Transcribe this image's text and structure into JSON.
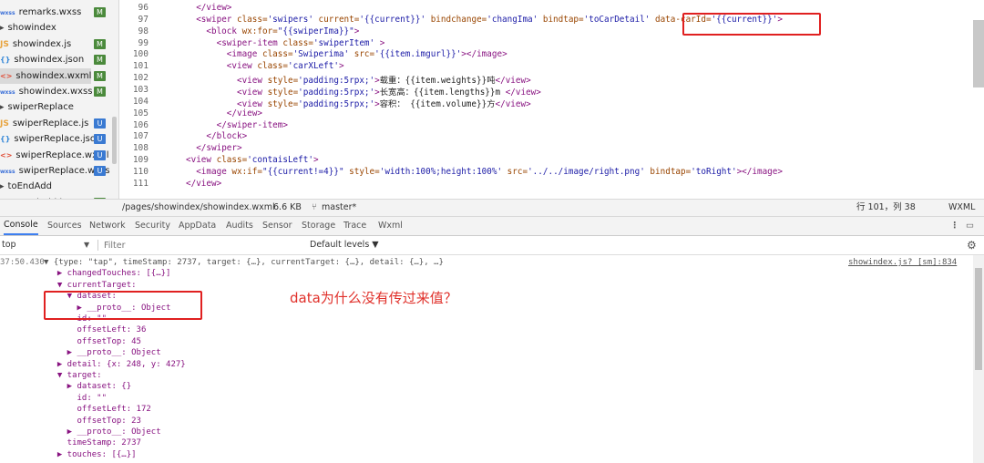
{
  "file_tree": [
    {
      "icon": "wxss",
      "label": "remarks.wxss",
      "badge": "M"
    },
    {
      "icon": "folder",
      "label": "showindex",
      "badge": ""
    },
    {
      "icon": "js",
      "label": "showindex.js",
      "badge": "M"
    },
    {
      "icon": "json",
      "label": "showindex.json",
      "badge": "M"
    },
    {
      "icon": "wxml",
      "label": "showindex.wxml",
      "badge": "M"
    },
    {
      "icon": "wxss",
      "label": "showindex.wxss",
      "badge": "M"
    },
    {
      "icon": "folder",
      "label": "swiperReplace",
      "badge": ""
    },
    {
      "icon": "js",
      "label": "swiperReplace.js",
      "badge": "U"
    },
    {
      "icon": "json",
      "label": "swiperReplace.json",
      "badge": "U"
    },
    {
      "icon": "wxml",
      "label": "swiperReplace.wxml",
      "badge": "U"
    },
    {
      "icon": "wxss",
      "label": "swiperReplace.wxss",
      "badge": "U"
    },
    {
      "icon": "folder",
      "label": "toEndAdd",
      "badge": ""
    },
    {
      "icon": "js",
      "label": "toEndAdd.js",
      "badge": "M"
    }
  ],
  "icon_glyphs": {
    "wxss": "wxss",
    "js": "JS",
    "json": "{}",
    "wxml": "<>",
    "folder": "▸"
  },
  "editor": {
    "line_numbers": [
      "96",
      "97",
      "98",
      "99",
      "100",
      "101",
      "102",
      "103",
      "104",
      "105",
      "106",
      "107",
      "108",
      "109",
      "110",
      "111"
    ],
    "lines": [
      [
        {
          "c": "txt",
          "t": "  "
        },
        {
          "c": "tag",
          "t": "</view>"
        }
      ],
      [
        {
          "c": "txt",
          "t": "  "
        },
        {
          "c": "tag",
          "t": "<swiper"
        },
        {
          "c": "attr",
          "t": " class="
        },
        {
          "c": "val",
          "t": "'swipers'"
        },
        {
          "c": "attr",
          "t": " current="
        },
        {
          "c": "val",
          "t": "'{{current}}'"
        },
        {
          "c": "attr",
          "t": " bindchange="
        },
        {
          "c": "val",
          "t": "'changIma'"
        },
        {
          "c": "attr",
          "t": " bindtap="
        },
        {
          "c": "val",
          "t": "'toCarDetail'"
        },
        {
          "c": "attr",
          "t": " data-carId="
        },
        {
          "c": "val",
          "t": "'{{current}}'"
        },
        {
          "c": "tag",
          "t": ">"
        }
      ],
      [
        {
          "c": "txt",
          "t": "    "
        },
        {
          "c": "tag",
          "t": "<block"
        },
        {
          "c": "attr",
          "t": " wx:for="
        },
        {
          "c": "val",
          "t": "\"{{swiperIma}}\""
        },
        {
          "c": "tag",
          "t": ">"
        }
      ],
      [
        {
          "c": "txt",
          "t": "      "
        },
        {
          "c": "tag",
          "t": "<swiper-item"
        },
        {
          "c": "attr",
          "t": " class="
        },
        {
          "c": "val",
          "t": "'swiperItem'"
        },
        {
          "c": "tag",
          "t": " >"
        }
      ],
      [
        {
          "c": "txt",
          "t": "        "
        },
        {
          "c": "tag",
          "t": "<image"
        },
        {
          "c": "attr",
          "t": " class="
        },
        {
          "c": "val",
          "t": "'Swiperima'"
        },
        {
          "c": "attr",
          "t": " src="
        },
        {
          "c": "val",
          "t": "'{{item.imgurl}}'"
        },
        {
          "c": "tag",
          "t": "></image>"
        }
      ],
      [
        {
          "c": "txt",
          "t": "        "
        },
        {
          "c": "tag",
          "t": "<view"
        },
        {
          "c": "attr",
          "t": " class="
        },
        {
          "c": "val",
          "t": "'carXLeft'"
        },
        {
          "c": "tag",
          "t": ">"
        }
      ],
      [
        {
          "c": "txt",
          "t": "          "
        },
        {
          "c": "tag",
          "t": "<view"
        },
        {
          "c": "attr",
          "t": " style="
        },
        {
          "c": "val",
          "t": "'padding:5rpx;'"
        },
        {
          "c": "tag",
          "t": ">"
        },
        {
          "c": "txt",
          "t": "载重：{{item.weights}}吨"
        },
        {
          "c": "tag",
          "t": "</view>"
        }
      ],
      [
        {
          "c": "txt",
          "t": "          "
        },
        {
          "c": "tag",
          "t": "<view"
        },
        {
          "c": "attr",
          "t": " style="
        },
        {
          "c": "val",
          "t": "'padding:5rpx;'"
        },
        {
          "c": "tag",
          "t": ">"
        },
        {
          "c": "txt",
          "t": "长宽高：{{item.lengths}}m "
        },
        {
          "c": "tag",
          "t": "</view>"
        }
      ],
      [
        {
          "c": "txt",
          "t": "          "
        },
        {
          "c": "tag",
          "t": "<view"
        },
        {
          "c": "attr",
          "t": " style="
        },
        {
          "c": "val",
          "t": "'padding:5rpx;'"
        },
        {
          "c": "tag",
          "t": ">"
        },
        {
          "c": "txt",
          "t": "容积： {{item.volume}}方"
        },
        {
          "c": "tag",
          "t": "</view>"
        }
      ],
      [
        {
          "c": "txt",
          "t": "        "
        },
        {
          "c": "tag",
          "t": "</view>"
        }
      ],
      [
        {
          "c": "txt",
          "t": "      "
        },
        {
          "c": "tag",
          "t": "</swiper-item>"
        }
      ],
      [
        {
          "c": "txt",
          "t": "    "
        },
        {
          "c": "tag",
          "t": "</block>"
        }
      ],
      [
        {
          "c": "txt",
          "t": "  "
        },
        {
          "c": "tag",
          "t": "</swiper>"
        }
      ],
      [
        {
          "c": "tag",
          "t": "<view"
        },
        {
          "c": "attr",
          "t": " class="
        },
        {
          "c": "val",
          "t": "'contaisLeft'"
        },
        {
          "c": "tag",
          "t": ">"
        }
      ],
      [
        {
          "c": "txt",
          "t": "  "
        },
        {
          "c": "tag",
          "t": "<image"
        },
        {
          "c": "attr",
          "t": " wx:if="
        },
        {
          "c": "val",
          "t": "\"{{current!=4}}\""
        },
        {
          "c": "attr",
          "t": " style="
        },
        {
          "c": "val",
          "t": "'width:100%;height:100%'"
        },
        {
          "c": "attr",
          "t": " src="
        },
        {
          "c": "val",
          "t": "'../../image/right.png'"
        },
        {
          "c": "attr",
          "t": " bindtap="
        },
        {
          "c": "val",
          "t": "'toRight'"
        },
        {
          "c": "tag",
          "t": "></image>"
        }
      ],
      [
        {
          "c": "tag",
          "t": "</view>"
        }
      ]
    ]
  },
  "status": {
    "path": "/pages/showindex/showindex.wxml",
    "size": "6.6 KB",
    "branch": "master*",
    "position": "行 101，列 38",
    "lang": "WXML"
  },
  "devtools_tabs": [
    "Console",
    "Sources",
    "Network",
    "Security",
    "AppData",
    "Audits",
    "Sensor",
    "Storage",
    "Trace",
    "Wxml"
  ],
  "filter": {
    "context": "top",
    "placeholder": "Filter",
    "levels": "Default levels ▼"
  },
  "console": {
    "time": "37:50.430",
    "source": "showindex.js? [sm]:834",
    "lines": [
      "▼ {type: \"tap\", timeStamp: 2737, target: {…}, currentTarget: {…}, detail: {…}, …}",
      "  ▶ changedTouches: [{…}]",
      "  ▼ currentTarget:",
      "    ▼ dataset:",
      "      ▶ __proto__: Object",
      "      id: \"\"",
      "      offsetLeft: 36",
      "      offsetTop: 45",
      "    ▶ __proto__: Object",
      "  ▶ detail: {x: 248, y: 427}",
      "  ▼ target:",
      "    ▶ dataset: {}",
      "      id: \"\"",
      "      offsetLeft: 172",
      "      offsetTop: 23",
      "    ▶ __proto__: Object",
      "    timeStamp: 2737",
      "  ▶ touches: [{…}]"
    ],
    "annotation": "data为什么没有传过来值？"
  },
  "colors": {
    "highlight": "#e02020",
    "badge_m": "#4b8a3c",
    "badge_u": "#3a7ad2",
    "accent": "#3d7ff0"
  }
}
